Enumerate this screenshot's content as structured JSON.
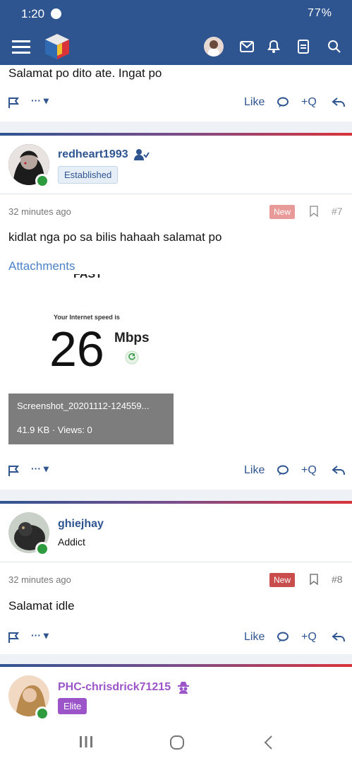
{
  "status_bar": {
    "time": "1:20",
    "system_icons_text": "77%"
  },
  "navbar": {
    "menu_icon": "menu-icon",
    "logo": "cube-logo",
    "icons": [
      "avatar",
      "mail-icon",
      "bell-icon",
      "document-icon",
      "search-icon"
    ]
  },
  "posts": [
    {
      "text": "Salamat po dito ate. Ingat po",
      "actions": {
        "like": "Like",
        "plusq": "+Q"
      }
    },
    {
      "username": "redheart1993",
      "badge": "Established",
      "time": "32 minutes ago",
      "new": "New",
      "number": "#7",
      "text": "kidlat nga po sa bilis hahaah salamat po",
      "attachments_label": "Attachments",
      "attachment": {
        "thumb_headline": "FAST",
        "thumb_subtitle": "Your Internet speed is",
        "thumb_value": "26",
        "thumb_unit": "Mbps",
        "filename": "Screenshot_20201112-124559...",
        "meta": "41.9 KB · Views: 0"
      },
      "actions": {
        "like": "Like",
        "plusq": "+Q"
      }
    },
    {
      "username": "ghiejhay",
      "badge": "Addict",
      "time": "32 minutes ago",
      "new": "New",
      "number": "#8",
      "text": "Salamat idle",
      "actions": {
        "like": "Like",
        "plusq": "+Q"
      }
    },
    {
      "username": "PHC-chrisdrick71215",
      "badge": "Elite"
    }
  ],
  "colors": {
    "brand": "#2f5591",
    "online": "#2e9b3e",
    "new_badge": "#c94d4d",
    "elite": "#9b55c9"
  }
}
